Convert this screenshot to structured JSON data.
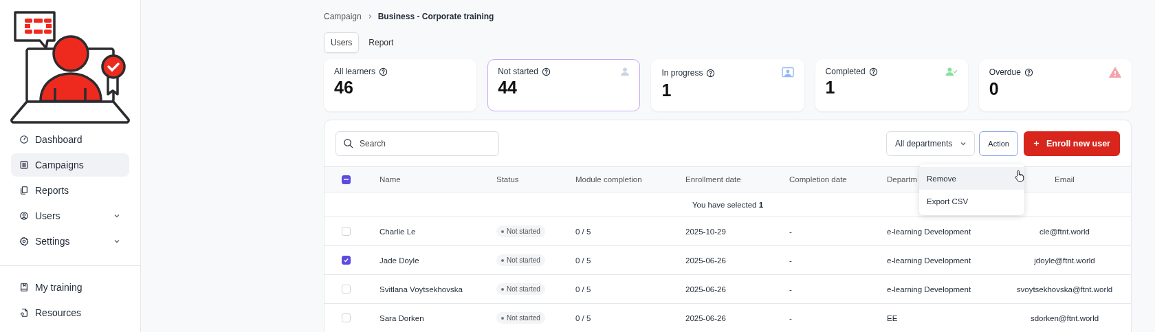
{
  "sidebar": {
    "nav": [
      {
        "label": "Dashboard",
        "selected": false
      },
      {
        "label": "Campaigns",
        "selected": true
      },
      {
        "label": "Reports",
        "selected": false
      },
      {
        "label": "Users",
        "selected": false,
        "expanded": false
      },
      {
        "label": "Settings",
        "selected": false,
        "expanded": false
      }
    ],
    "bottom_nav": [
      {
        "label": "My training",
        "selected": false
      },
      {
        "label": "Resources",
        "selected": false
      }
    ]
  },
  "breadcrumb": [
    {
      "label": "Campaign",
      "current": false
    },
    {
      "label": "Business - Corporate training",
      "current": true
    }
  ],
  "tabs": [
    {
      "label": "Users",
      "selected": true
    },
    {
      "label": "Report",
      "selected": false
    }
  ],
  "stats": [
    {
      "kind": "all",
      "label": "All learners",
      "value": "46",
      "selected": false
    },
    {
      "kind": "not_started",
      "label": "Not started",
      "value": "44",
      "selected": true
    },
    {
      "kind": "in_progress",
      "label": "In progress",
      "value": "1",
      "selected": false
    },
    {
      "kind": "completed",
      "label": "Completed",
      "value": "1",
      "selected": false
    },
    {
      "kind": "overdue",
      "label": "Overdue",
      "value": "0",
      "selected": false
    }
  ],
  "toolbar": {
    "search": {
      "placeholder": "Search"
    },
    "department_filter": "All departments",
    "action_button": "Action",
    "enroll_button": "Enroll new user"
  },
  "action_menu": {
    "items": [
      {
        "label": "Remove",
        "selected": true
      },
      {
        "label": "Export CSV",
        "selected": false
      }
    ]
  },
  "table": {
    "select_all": {
      "indeterminate": true
    },
    "columns": [
      "Name",
      "Status",
      "Module completion",
      "Enrollment date",
      "Completion date",
      "Departm",
      "Email"
    ],
    "selection_note": "You have selected **1**",
    "rows": [
      {
        "checked": false,
        "name": "Charlie Le",
        "status": "Not started",
        "module_completion": "0 / 5",
        "enrollment_date": "2025-10-29",
        "completion_date": "-",
        "department": "e-learning Development",
        "email": "cle@ftnt.world"
      },
      {
        "checked": true,
        "name": "Jade Doyle",
        "status": "Not started",
        "module_completion": "0 / 5",
        "enrollment_date": "2025-06-26",
        "completion_date": "-",
        "department": "e-learning Development",
        "email": "jdoyle@ftnt.world"
      },
      {
        "checked": false,
        "name": "Svitlana Voytsekhovska",
        "status": "Not started",
        "module_completion": "0 / 5",
        "enrollment_date": "2025-06-26",
        "completion_date": "-",
        "department": "e-learning Development",
        "email": "svoytsekhovska@ftnt.world"
      },
      {
        "checked": false,
        "name": "Sara Dorken",
        "status": "Not started",
        "module_completion": "0 / 5",
        "enrollment_date": "2025-06-26",
        "completion_date": "-",
        "department": "EE",
        "email": "sdorken@ftnt.world"
      }
    ]
  }
}
